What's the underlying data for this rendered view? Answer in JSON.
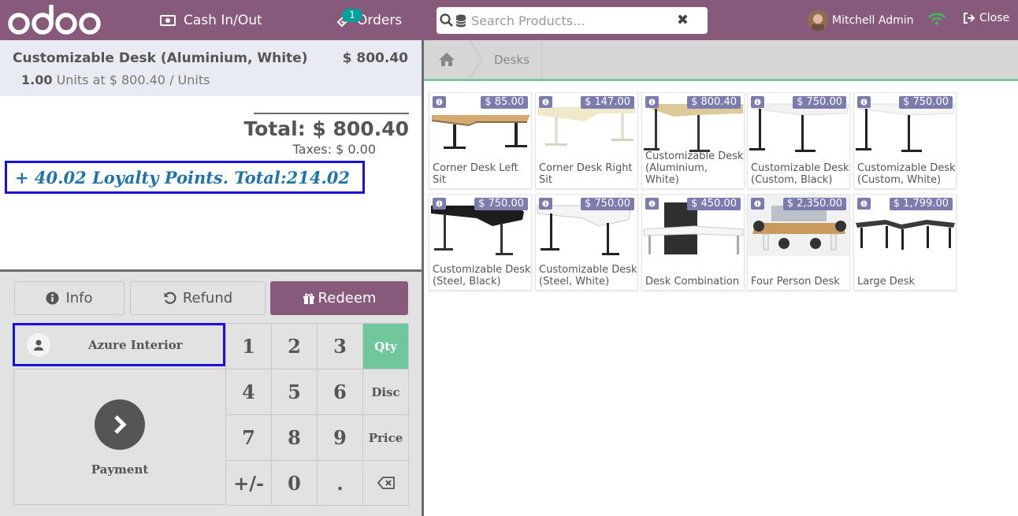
{
  "topbar": {
    "logo_text": "odoo",
    "cash_label": "Cash In/Out",
    "orders_label": "Orders",
    "orders_count": "1",
    "search_placeholder": "Search Products...",
    "user_name": "Mitchell Admin",
    "close_label": "Close"
  },
  "order": {
    "line": {
      "name": "Customizable Desk (Aluminium, White)",
      "price": "$ 800.40",
      "qty": "1.00",
      "info": "Units at $ 800.40 / Units"
    },
    "total": "Total: $ 800.40",
    "taxes": "Taxes: $ 0.00",
    "loyalty": "+ 40.02 Loyalty Points. Total:214.02"
  },
  "controls": {
    "info_label": "Info",
    "refund_label": "Refund",
    "redeem_label": "Redeem",
    "customer_name": "Azure Interior",
    "payment_label": "Payment"
  },
  "numpad": {
    "keys": [
      "1",
      "2",
      "3",
      "Qty",
      "4",
      "5",
      "6",
      "Disc",
      "7",
      "8",
      "9",
      "Price",
      "+/-",
      "0",
      "."
    ],
    "active_mode": "Qty"
  },
  "breadcrumb": {
    "category": "Desks"
  },
  "products": [
    {
      "name": "Corner Desk Left Sit",
      "price": "$ 85.00"
    },
    {
      "name": "Corner Desk Right Sit",
      "price": "$ 147.00"
    },
    {
      "name": "Customizable Desk (Aluminium, White)",
      "price": "$ 800.40"
    },
    {
      "name": "Customizable Desk (Custom, Black)",
      "price": "$ 750.00"
    },
    {
      "name": "Customizable Desk (Custom, White)",
      "price": "$ 750.00"
    },
    {
      "name": "Customizable Desk (Steel, Black)",
      "price": "$ 750.00"
    },
    {
      "name": "Customizable Desk (Steel, White)",
      "price": "$ 750.00"
    },
    {
      "name": "Desk Combination",
      "price": "$ 450.00"
    },
    {
      "name": "Four Person Desk",
      "price": "$ 2,350.00"
    },
    {
      "name": "Large Desk",
      "price": "$ 1,799.00"
    }
  ],
  "colors": {
    "brand": "#875a7b",
    "active_mode": "#6ec89b",
    "price_badge": "#7c7bad",
    "highlight_border": "#1a11d8",
    "loyalty_text": "#1f74a8"
  }
}
